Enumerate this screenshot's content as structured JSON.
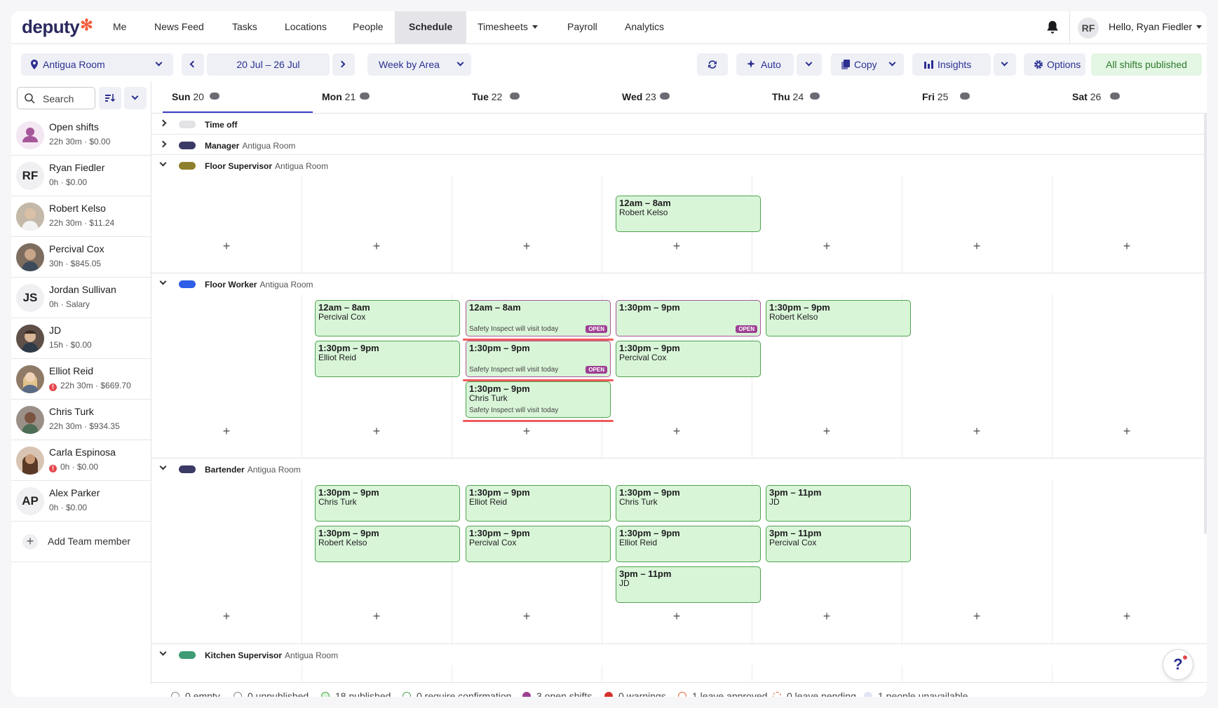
{
  "app": {
    "logo": "deputy",
    "logo_mark": "✻"
  },
  "nav": {
    "items": [
      {
        "label": "Me"
      },
      {
        "label": "News Feed"
      },
      {
        "label": "Tasks"
      },
      {
        "label": "Locations"
      },
      {
        "label": "People"
      },
      {
        "label": "Schedule",
        "active": true
      },
      {
        "label": "Timesheets",
        "dropdown": true
      },
      {
        "label": "Payroll"
      },
      {
        "label": "Analytics"
      }
    ],
    "user_initials": "RF",
    "greeting": "Hello, Ryan Fiedler"
  },
  "toolbar": {
    "location": "Antigua Room",
    "date_range": "20 Jul – 26 Jul",
    "view": "Week by Area",
    "auto": "Auto",
    "copy": "Copy",
    "insights": "Insights",
    "options": "Options",
    "publish_status": "All shifts published"
  },
  "search": {
    "placeholder": "Search"
  },
  "days": [
    {
      "name": "Sun",
      "num": "20",
      "weather": "cloud-icon"
    },
    {
      "name": "Mon",
      "num": "21",
      "weather": "cloud-icon"
    },
    {
      "name": "Tue",
      "num": "22",
      "weather": "rain-icon"
    },
    {
      "name": "Wed",
      "num": "23",
      "weather": "partly-sunny-icon"
    },
    {
      "name": "Thu",
      "num": "24",
      "weather": "rain-icon"
    },
    {
      "name": "Fri",
      "num": "25",
      "weather": "cloud-icon"
    },
    {
      "name": "Sat",
      "num": "26",
      "weather": "rain-icon"
    }
  ],
  "members": [
    {
      "name": "Open shifts",
      "sub": "22h 30m · $0.00",
      "initials": "",
      "avatar_color": "#f3e7f3"
    },
    {
      "name": "Ryan Fiedler",
      "sub": "0h · $0.00",
      "initials": "RF",
      "avatar_color": "#f0f0f2"
    },
    {
      "name": "Robert Kelso",
      "sub": "22h 30m · $11.24",
      "initials": "",
      "avatar_color": "#b8a996"
    },
    {
      "name": "Percival Cox",
      "sub": "30h · $845.05",
      "initials": "",
      "avatar_color": "#8c7b6b"
    },
    {
      "name": "Jordan Sullivan",
      "sub": "0h · Salary",
      "initials": "JS",
      "avatar_color": "#f0f0f2"
    },
    {
      "name": "JD",
      "sub": "15h · $0.00",
      "initials": "",
      "avatar_color": "#6b5a4e"
    },
    {
      "name": "Elliot Reid",
      "sub": "22h 30m · $669.70",
      "initials": "",
      "avatar_color": "#c7a57f",
      "warning": true
    },
    {
      "name": "Chris Turk",
      "sub": "22h 30m · $934.35",
      "initials": "",
      "avatar_color": "#6a5142"
    },
    {
      "name": "Carla Espinosa",
      "sub": "0h · $0.00",
      "initials": "",
      "avatar_color": "#9c6b4e",
      "warning": true
    },
    {
      "name": "Alex Parker",
      "sub": "0h · $0.00",
      "initials": "AP",
      "avatar_color": "#f0f0f2"
    }
  ],
  "add_member": "Add Team member",
  "areas": {
    "time_off": {
      "name": "Time off",
      "location": "",
      "color": "#e3e3e6"
    },
    "manager": {
      "name": "Manager",
      "location": "Antigua Room",
      "color": "#3b3a66"
    },
    "floor_supervisor": {
      "name": "Floor Supervisor",
      "location": "Antigua Room",
      "color": "#8e7f2e"
    },
    "floor_worker": {
      "name": "Floor Worker",
      "location": "Antigua Room",
      "color": "#2f5ee6"
    },
    "bartender": {
      "name": "Bartender",
      "location": "Antigua Room",
      "color": "#3b3a66"
    },
    "kitchen_supervisor": {
      "name": "Kitchen Supervisor",
      "location": "Antigua Room",
      "color": "#3e9b73"
    }
  },
  "shifts": {
    "fs_wed": {
      "time": "12am – 8am",
      "who": "Robert Kelso"
    },
    "fw_mon_1": {
      "time": "12am – 8am",
      "who": "Percival Cox"
    },
    "fw_mon_2": {
      "time": "1:30pm – 9pm",
      "who": "Elliot Reid"
    },
    "fw_tue_1": {
      "time": "12am – 8am",
      "who": "",
      "note": "Safety Inspect will visit today",
      "badge": "OPEN"
    },
    "fw_tue_2": {
      "time": "1:30pm – 9pm",
      "who": "",
      "note": "Safety Inspect will visit today",
      "badge": "OPEN"
    },
    "fw_tue_3": {
      "time": "1:30pm – 9pm",
      "who": "Chris Turk",
      "note": "Safety Inspect will visit today"
    },
    "fw_wed_1": {
      "time": "1:30pm – 9pm",
      "who": "",
      "badge": "OPEN"
    },
    "fw_wed_2": {
      "time": "1:30pm – 9pm",
      "who": "Percival Cox"
    },
    "fw_thu_1": {
      "time": "1:30pm – 9pm",
      "who": "Robert Kelso"
    },
    "bt_mon_1": {
      "time": "1:30pm – 9pm",
      "who": "Chris Turk"
    },
    "bt_mon_2": {
      "time": "1:30pm – 9pm",
      "who": "Robert Kelso"
    },
    "bt_tue_1": {
      "time": "1:30pm – 9pm",
      "who": "Elliot Reid"
    },
    "bt_tue_2": {
      "time": "1:30pm – 9pm",
      "who": "Percival Cox"
    },
    "bt_wed_1": {
      "time": "1:30pm – 9pm",
      "who": "Chris Turk"
    },
    "bt_wed_2": {
      "time": "1:30pm – 9pm",
      "who": "Elliot Reid"
    },
    "bt_wed_3": {
      "time": "3pm – 11pm",
      "who": "JD"
    },
    "bt_thu_1": {
      "time": "3pm – 11pm",
      "who": "JD"
    },
    "bt_thu_2": {
      "time": "3pm – 11pm",
      "who": "Percival Cox"
    }
  },
  "legend": [
    {
      "label": "0 empty",
      "color": "#ffffff",
      "border": "#888888"
    },
    {
      "label": "0 unpublished",
      "color": "#ffffff",
      "border": "#888888"
    },
    {
      "label": "18 published",
      "color": "#d9f5d8",
      "border": "#4ea24e"
    },
    {
      "label": "0 require confirmation",
      "color": "#ffffff",
      "border": "#4ea24e"
    },
    {
      "label": "3 open shifts",
      "color": "#9d3f93",
      "border": "#9d3f93"
    },
    {
      "label": "0 warnings",
      "color": "#d4322c",
      "border": "#d4322c"
    },
    {
      "label": "1 leave approved",
      "color": "#ffffff",
      "border": "#e0653a"
    },
    {
      "label": "0 leave pending",
      "color": "#ffffff",
      "border": "#e0653a"
    },
    {
      "label": "1 people unavailable",
      "color": "#e4e4f6",
      "border": "#e4e4f6"
    }
  ],
  "help": "?"
}
